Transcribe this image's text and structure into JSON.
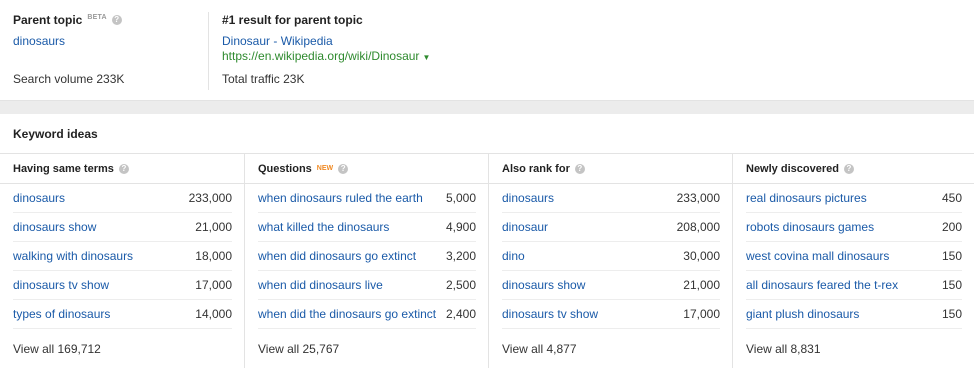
{
  "parent_topic": {
    "label": "Parent topic",
    "badge": "BETA",
    "link": "dinosaurs",
    "volume": "Search volume 233K"
  },
  "top_result": {
    "label": "#1 result for parent topic",
    "title": "Dinosaur - Wikipedia",
    "url": "https://en.wikipedia.org/wiki/Dinosaur",
    "traffic": "Total traffic 23K"
  },
  "keyword_ideas": {
    "heading": "Keyword ideas",
    "columns": [
      {
        "title": "Having same terms",
        "badge": "",
        "rows": [
          {
            "keyword": "dinosaurs",
            "volume": "233,000"
          },
          {
            "keyword": "dinosaurs show",
            "volume": "21,000"
          },
          {
            "keyword": "walking with dinosaurs",
            "volume": "18,000"
          },
          {
            "keyword": "dinosaurs tv show",
            "volume": "17,000"
          },
          {
            "keyword": "types of dinosaurs",
            "volume": "14,000"
          }
        ],
        "view_all": "View all 169,712"
      },
      {
        "title": "Questions",
        "badge": "NEW",
        "rows": [
          {
            "keyword": "when dinosaurs ruled the earth",
            "volume": "5,000"
          },
          {
            "keyword": "what killed the dinosaurs",
            "volume": "4,900"
          },
          {
            "keyword": "when did dinosaurs go extinct",
            "volume": "3,200"
          },
          {
            "keyword": "when did dinosaurs live",
            "volume": "2,500"
          },
          {
            "keyword": "when did the dinosaurs go extinct",
            "volume": "2,400"
          }
        ],
        "view_all": "View all 25,767"
      },
      {
        "title": "Also rank for",
        "badge": "",
        "rows": [
          {
            "keyword": "dinosaurs",
            "volume": "233,000"
          },
          {
            "keyword": "dinosaur",
            "volume": "208,000"
          },
          {
            "keyword": "dino",
            "volume": "30,000"
          },
          {
            "keyword": "dinosaurs show",
            "volume": "21,000"
          },
          {
            "keyword": "dinosaurs tv show",
            "volume": "17,000"
          }
        ],
        "view_all": "View all 4,877"
      },
      {
        "title": "Newly discovered",
        "badge": "",
        "rows": [
          {
            "keyword": "real dinosaurs pictures",
            "volume": "450"
          },
          {
            "keyword": "robots dinosaurs games",
            "volume": "200"
          },
          {
            "keyword": "west covina mall dinosaurs",
            "volume": "150"
          },
          {
            "keyword": "all dinosaurs feared the t-rex",
            "volume": "150"
          },
          {
            "keyword": "giant plush dinosaurs",
            "volume": "150"
          }
        ],
        "view_all": "View all 8,831"
      }
    ]
  },
  "icons": {
    "help": "help-circle-icon",
    "url_menu": "caret-down-icon"
  },
  "colors": {
    "link": "#1a5aa8",
    "url": "#2e8a2e",
    "new_badge": "#f08a24"
  }
}
